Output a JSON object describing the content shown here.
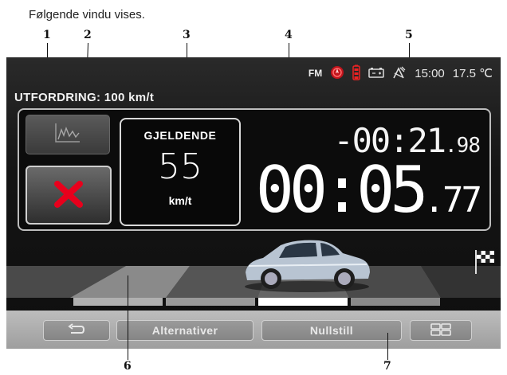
{
  "caption": "Følgende vindu vises.",
  "callouts": [
    "1",
    "2",
    "3",
    "4",
    "5",
    "6",
    "7"
  ],
  "status": {
    "radio_source": "FM",
    "time": "15:00",
    "temperature": "17.5 ℃"
  },
  "challenge_title": "UTFORDRING: 100 km/t",
  "current": {
    "label": "GJELDENDE",
    "value": "55",
    "unit": "km/t"
  },
  "delta_time": {
    "main": "-00:21",
    "fraction": ".98"
  },
  "elapsed_time": {
    "main": "00:05",
    "fraction": ".77"
  },
  "buttons": {
    "back_icon": "back-arrow-icon",
    "options": "Alternativer",
    "reset": "Nullstill",
    "menu_icon": "grid-icon"
  },
  "colors": {
    "cancel_red": "#e8001c",
    "screen_bg": "#141414",
    "bottom_bar": "#a8a8a8"
  }
}
